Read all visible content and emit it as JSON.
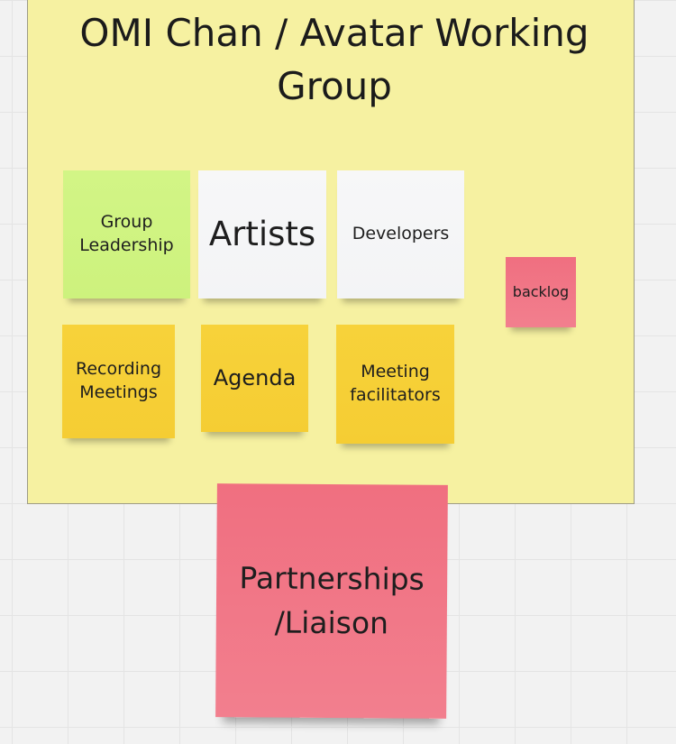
{
  "board": {
    "frame_title": "OMI Chan / Avatar Working Group",
    "stickies": {
      "group_leadership": "Group Leadership",
      "artists": "Artists",
      "developers": "Developers",
      "backlog": "backlog",
      "recording_meetings": "Recording Meetings",
      "agenda": "Agenda",
      "meeting_facilitators": "Meeting facilitators",
      "partnerships": "Partnerships /Liaison"
    }
  },
  "colors": {
    "canvas": "#f2f2f2",
    "frame": "#f6f1a1",
    "sticky_green": "#cdf27d",
    "sticky_white": "#f4f5f7",
    "sticky_yellow": "#f5cd33",
    "sticky_pink": "#f27584"
  }
}
